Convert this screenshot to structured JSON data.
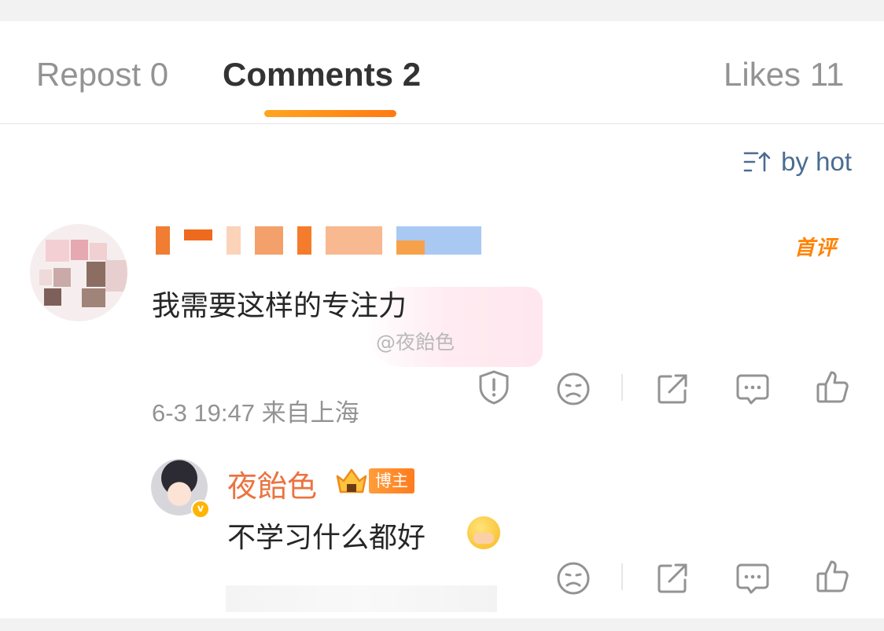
{
  "tabs": {
    "repost": {
      "label": "Repost",
      "count": "0"
    },
    "comments": {
      "label": "Comments",
      "count": "2"
    },
    "likes": {
      "label": "Likes",
      "count": "11"
    }
  },
  "sort": {
    "label": "by hot",
    "icon": "sort-icon"
  },
  "comment": {
    "badge": "首评",
    "text": "我需要这样的专注力",
    "watermark": "@夜飴色",
    "time": "6-3 19:47",
    "location": "来自上海",
    "actions": [
      "report-icon",
      "dislike-icon",
      "share-icon",
      "comment-icon",
      "like-icon"
    ]
  },
  "reply": {
    "author": "夜飴色",
    "author_badge": "博主",
    "text": "不学习什么都好",
    "emoji": "crying-emoji",
    "actions": [
      "dislike-icon",
      "share-icon",
      "comment-icon",
      "like-icon"
    ]
  },
  "colors": {
    "accent": "#ff8200",
    "link": "#4b6c92",
    "author": "#eb7340",
    "muted": "#939393"
  }
}
